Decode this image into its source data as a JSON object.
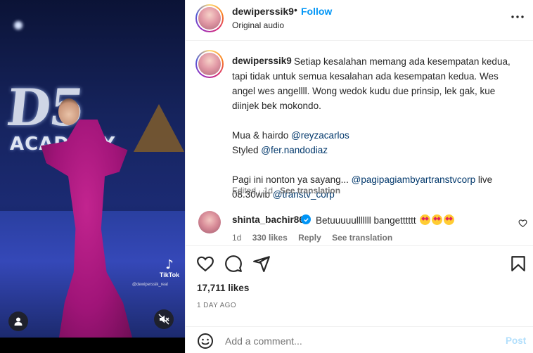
{
  "header": {
    "username": "dewiperssik9",
    "separator": "•",
    "follow_label": "Follow",
    "audio_label": "Original audio"
  },
  "media": {
    "tiktok_label": "TikTok",
    "watermark": "@dewiperssik_real",
    "logo_text": "D5",
    "academy_text": "ACADEMY",
    "muted": true
  },
  "caption": {
    "username": "dewiperssik9",
    "text_line1": "Setiap kesalahan memang ada kesempatan kedua, tapi tidak untuk semua kesalahan ada kesempatan kedua. Wes angel wes angellll. Wong wedok kudu due prinsip, lek gak, kue diinjek bek mokondo.",
    "mua_prefix": "Mua & hairdo ",
    "mua_mention": "@reyzacarlos",
    "styled_prefix": "Styled ",
    "styled_mention": "@fer.nandodiaz",
    "pagi_prefix": "Pagi ini nonton ya sayang... ",
    "pagi_mention": "@pagipagiambyartranstvcorp",
    "pagi_suffix": " live 08.30wib ",
    "transtv_mention": "@transtv_corp",
    "edited": "Edited",
    "time": "1d",
    "see_translation": "See translation"
  },
  "comment": {
    "username": "shinta_bachir86",
    "text": "Betuuuuulllllll bangetttttt",
    "time": "1d",
    "likes": "330 likes",
    "reply": "Reply",
    "see_translation": "See translation"
  },
  "stats": {
    "likes": "17,711 likes",
    "date": "1 DAY AGO"
  },
  "add_comment": {
    "placeholder": "Add a comment...",
    "post_label": "Post"
  },
  "colors": {
    "accent": "#0095f6",
    "mention": "#00376b",
    "muted_text": "#737373",
    "post_disabled": "#b2dffc"
  }
}
